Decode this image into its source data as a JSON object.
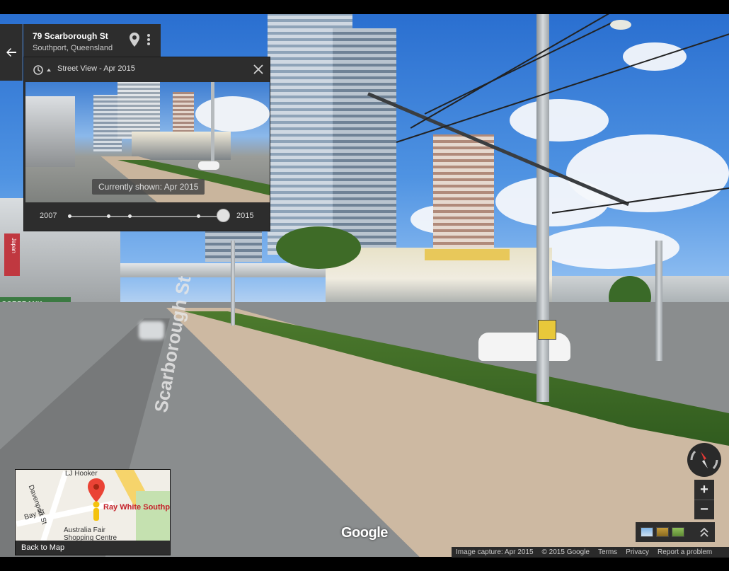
{
  "place": {
    "title": "79 Scarborough St",
    "subtitle": "Southport, Queensland"
  },
  "time_machine": {
    "title": "Street View - Apr 2015",
    "tooltip": "Currently shown: Apr 2015",
    "year_start": "2007",
    "year_end": "2015"
  },
  "scene_labels": {
    "bank_sign": "CORPBANK",
    "japan_sign": "Japan",
    "street_name": "Scarborough St"
  },
  "minimap": {
    "labels": [
      "LJ Hooker",
      "Davenport St",
      "Bay St",
      "Australia Fair",
      "Shopping Centre"
    ],
    "place_label": "Ray White Southp",
    "back_label": "Back to Map"
  },
  "controls": {
    "zoom_in": "+",
    "zoom_out": "−"
  },
  "logo": "Google",
  "footer": {
    "capture": "Image capture: Apr 2015",
    "copyright": "© 2015 Google",
    "terms": "Terms",
    "privacy": "Privacy",
    "report": "Report a problem"
  },
  "colors": {
    "panel_bg": "#2d2d2d",
    "pin_red": "#ea4335",
    "pegman_yellow": "#f4c20d",
    "compass_red": "#e53935"
  },
  "icons": {
    "back": "arrow-left-icon",
    "pin": "location-pin-icon",
    "more": "more-vert-icon",
    "history": "history-clock-icon",
    "close": "close-icon",
    "compass": "compass-icon",
    "collapse": "double-chevron-up-icon"
  }
}
